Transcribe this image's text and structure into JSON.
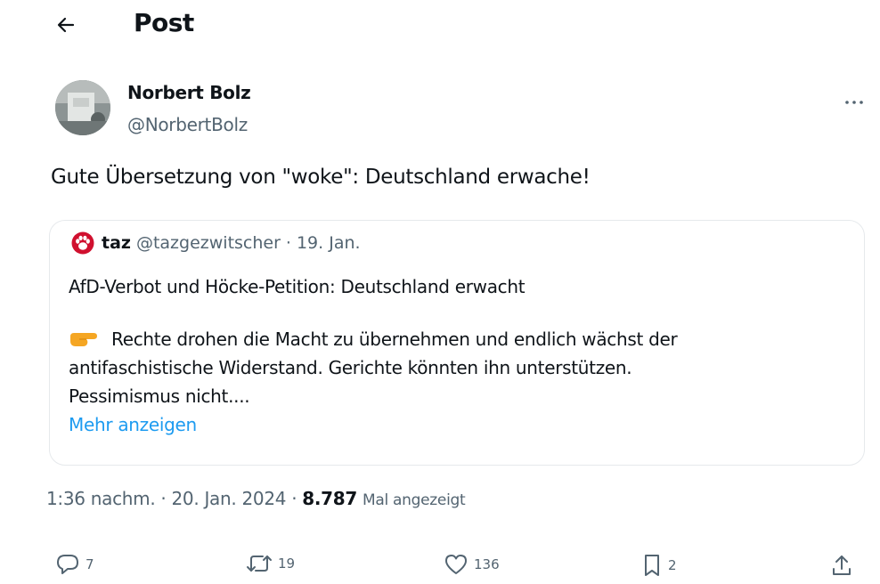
{
  "header": {
    "title": "Post",
    "back_icon": "arrow-left-icon"
  },
  "post": {
    "author_name": "Norbert Bolz",
    "author_handle": "@NorbertBolz",
    "text": "Gute Übersetzung von \"woke\": Deutschland erwache!",
    "more_icon": "more-horizontal-icon"
  },
  "quote": {
    "name": "taz",
    "handle": "@tazgezwitscher",
    "separator": "·",
    "date": "19. Jan.",
    "headline": "AfD-Verbot und Höcke-Petition: Deutschland erwacht",
    "body_line1": "Rechte drohen die Macht zu übernehmen und endlich wächst der",
    "body_line2": "antifaschistische Widerstand. Gerichte könnten ihn unterstützen.",
    "body_line3": "Pessimismus nicht....",
    "show_more": "Mehr anzeigen",
    "emoji": "pointing-right-emoji",
    "logo_icon": "taz-paw-logo"
  },
  "meta": {
    "time": "1:36 nachm.",
    "separator": "·",
    "date": "20. Jan. 2024",
    "views": "8.787",
    "views_label": "Mal angezeigt"
  },
  "actions": {
    "reply_count": "7",
    "repost_count": "19",
    "like_count": "136",
    "bookmark_count": "2"
  },
  "colors": {
    "text_primary": "#0f1419",
    "text_secondary": "#536471",
    "link": "#1d9bf0",
    "border": "#e6e9ec",
    "taz_red": "#d0102f"
  }
}
